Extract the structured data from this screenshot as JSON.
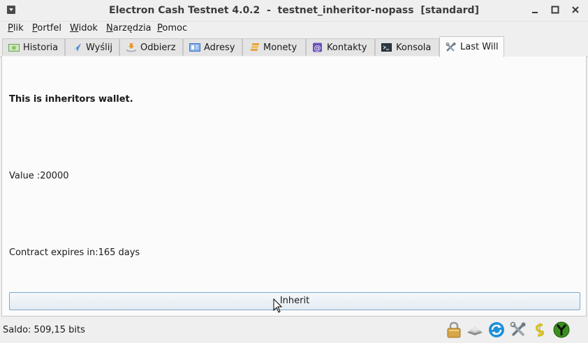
{
  "window": {
    "title": "Electron Cash Testnet 4.0.2  -  testnet_inheritor-nopass  [standard]"
  },
  "menu": [
    {
      "accel": "P",
      "rest": "lik"
    },
    {
      "accel": "P",
      "rest": "ortfel"
    },
    {
      "accel": "W",
      "rest": "idok"
    },
    {
      "accel": "N",
      "rest": "arzędzia"
    },
    {
      "accel": "P",
      "rest": "omoc"
    }
  ],
  "tabs": [
    {
      "label": "Historia",
      "icon": "history-icon"
    },
    {
      "label": "Wyślij",
      "icon": "send-icon"
    },
    {
      "label": "Odbierz",
      "icon": "receive-icon"
    },
    {
      "label": "Adresy",
      "icon": "addresses-icon"
    },
    {
      "label": "Monety",
      "icon": "coins-icon"
    },
    {
      "label": "Kontakty",
      "icon": "contacts-icon"
    },
    {
      "label": "Konsola",
      "icon": "console-icon"
    },
    {
      "label": "Last Will",
      "icon": "tools-icon",
      "active": true
    }
  ],
  "last_will": {
    "heading": "This is inheritors wallet.",
    "value_line": "Value :20000",
    "expires_line": "Contract expires in:165 days",
    "inherit_button": "Inherit"
  },
  "status": {
    "balance": "Saldo: 509,15 bits",
    "icons": [
      "lock-icon",
      "seed-icon",
      "sync-icon",
      "preferences-icon",
      "cashshuffle-icon",
      "network-icon"
    ]
  },
  "colors": {
    "accent_border": "#7fa7c8",
    "sync_blue": "#1e90d6",
    "network_green": "#3a8f1f"
  }
}
